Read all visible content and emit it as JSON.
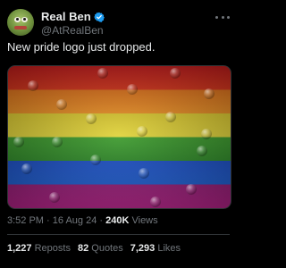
{
  "author": {
    "display_name": "Real Ben",
    "handle": "@AtRealBen",
    "verified": true,
    "avatar_icon": "frog-avatar-icon"
  },
  "tweet": {
    "text": "New pride logo just dropped.",
    "image_alt": "rainbow-flag-image",
    "stripe_colors": [
      "#c81d1d",
      "#e2751c",
      "#d9c72e",
      "#3c9a2c",
      "#1c4fc6",
      "#9a1f7a"
    ]
  },
  "meta": {
    "time": "3:52 PM",
    "date": "16 Aug 24",
    "views_count": "240K",
    "views_label": "Views"
  },
  "stats": {
    "reposts_count": "1,227",
    "reposts_label": "Reposts",
    "quotes_count": "82",
    "quotes_label": "Quotes",
    "likes_count": "7,293",
    "likes_label": "Likes"
  },
  "colors": {
    "background": "#000000",
    "text": "#e7e9ea",
    "muted": "#71767b",
    "verified": "#1d9bf0"
  }
}
